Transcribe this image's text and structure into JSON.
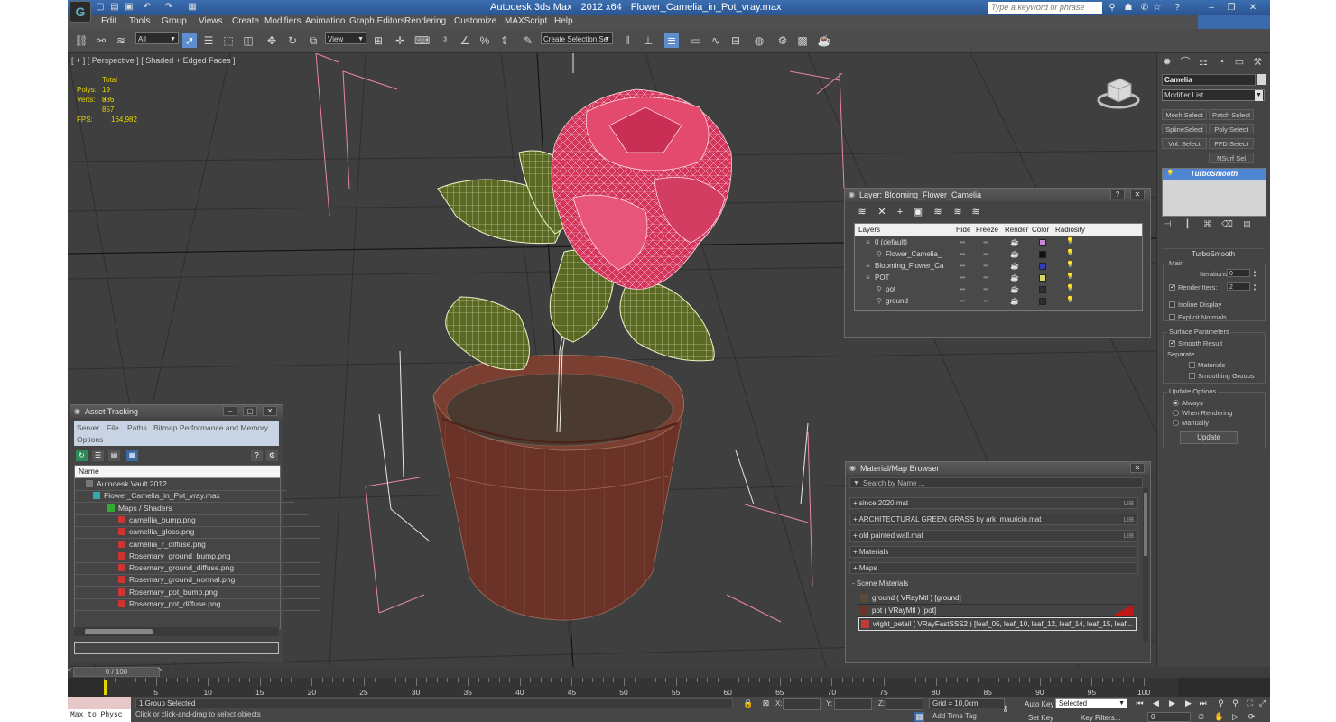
{
  "window": {
    "app_name": "Autodesk 3ds Max",
    "version": "2012 x64",
    "filename": "Flower_Camelia_in_Pot_vray.max",
    "search_placeholder": "Type a keyword or phrase"
  },
  "menu": [
    "Edit",
    "Tools",
    "Group",
    "Views",
    "Create",
    "Modifiers",
    "Animation",
    "Graph Editors",
    "Rendering",
    "Customize",
    "MAXScript",
    "Help"
  ],
  "toolbar": {
    "filter_value": "All",
    "refcoord_value": "View",
    "selection_set_value": "Create Selection Se"
  },
  "viewport": {
    "label": "[ + ] [ Perspective ] [ Shaded + Edged Faces ]",
    "stats_header": "Total",
    "polys_label": "Polys:",
    "polys": "19 336",
    "verts_label": "Verts:",
    "verts": "9 857",
    "fps_label": "FPS:",
    "fps": "164,982"
  },
  "command_panel": {
    "object_name": "Camelia",
    "modifier_list": "Modifier List",
    "buttons": [
      "Mesh Select",
      "Patch Select",
      "SplineSelect",
      "Poly Select",
      "Vol. Select",
      "FFD Select",
      "NSurf Sel"
    ],
    "stack_item": "TurboSmooth",
    "rollout_title": "TurboSmooth",
    "main_group": "Main",
    "iterations_label": "Iterations:",
    "iterations": "0",
    "render_iters_label": "Render Iters:",
    "render_iters": "2",
    "isoline": "Isoline Display",
    "explicit_normals": "Explicit Normals",
    "surface_group": "Surface Parameters",
    "smooth_result": "Smooth Result",
    "separate_label": "Separate",
    "materials": "Materials",
    "smoothing_groups": "Smoothing Groups",
    "update_group": "Update Options",
    "always": "Always",
    "when_rendering": "When Rendering",
    "manually": "Manually",
    "update_button": "Update",
    "check": "✓"
  },
  "layer_window": {
    "title": "Layer: Blooming_Flower_Camelia",
    "columns": [
      "Layers",
      "Hide",
      "Freeze",
      "Render",
      "Color",
      "Radiosity"
    ],
    "rows": [
      {
        "name": "0 (default)",
        "color": "#c48ad8"
      },
      {
        "name": "Flower_Camelia_",
        "color": "#101010"
      },
      {
        "name": "Blooming_Flower_Ca",
        "color": "#2c3fb8"
      },
      {
        "name": "POT",
        "color": "#d8d860"
      },
      {
        "name": "pot",
        "color": "#2e2e2e"
      },
      {
        "name": "ground",
        "color": "#2e2e2e"
      }
    ]
  },
  "asset_window": {
    "title": "Asset Tracking",
    "menu": [
      "Server",
      "File",
      "Paths",
      "Bitmap Performance and Memory",
      "Options"
    ],
    "column": "Name",
    "rows": [
      "Autodesk Vault 2012",
      "Flower_Camelia_in_Pot_vray.max",
      "Maps / Shaders",
      "camellia_bump.png",
      "camellia_gloss.png",
      "camellia_r_diffuse.png",
      "Rosemary_ground_bump.png",
      "Rosemary_ground_diffuse.png",
      "Rosemary_ground_normal.png",
      "Rosemary_pot_bump.png",
      "Rosemary_pot_diffuse.png"
    ]
  },
  "material_window": {
    "title": "Material/Map Browser",
    "search": "Search by Name ...",
    "libraries": [
      {
        "label": "+ since 2020.mat",
        "tag": "LIB"
      },
      {
        "label": "+ ARCHITECTURAL GREEN GRASS by ark_mauricio.mat",
        "tag": "LIB"
      },
      {
        "label": "+ old painted wall.mat",
        "tag": "LIB"
      },
      {
        "label": "+ Materials",
        "tag": ""
      },
      {
        "label": "+ Maps",
        "tag": ""
      },
      {
        "label": "- Scene Materials",
        "tag": ""
      }
    ],
    "scene_materials": [
      "ground  ( VRayMtl )  [ground]",
      "pot  ( VRayMtl )  [pot]",
      "wight_petail  ( VRayFastSSS2 )  [leaf_05, leaf_10, leaf_12, leaf_14, leaf_15, leaf..."
    ]
  },
  "timeline": {
    "slider": "0 / 100",
    "ticks": [
      "5",
      "10",
      "15",
      "20",
      "25",
      "30",
      "35",
      "40",
      "45",
      "50",
      "55",
      "60",
      "65",
      "70",
      "75",
      "80",
      "85",
      "90",
      "95",
      "100"
    ]
  },
  "status": {
    "maxscript": "Max to Physc",
    "selection": "1 Group Selected",
    "prompt": "Click or click-and-drag to select objects",
    "x_label": "X:",
    "y_label": "Y:",
    "z_label": "Z:",
    "grid": "Grid = 10,0cm",
    "add_time_tag": "Add Time Tag",
    "auto_key": "Auto Key",
    "set_key": "Set Key",
    "selected": "Selected",
    "key_filters": "Key Filters...",
    "frame": "0"
  },
  "colors": {
    "accent": "#4f86d3",
    "title_blue": "#2a5492",
    "stats_yellow": "#e6d400",
    "petal_wire": "#ff5f8a",
    "leaf_fill": "#5c6b2a",
    "pot_fill": "#6b3327"
  }
}
